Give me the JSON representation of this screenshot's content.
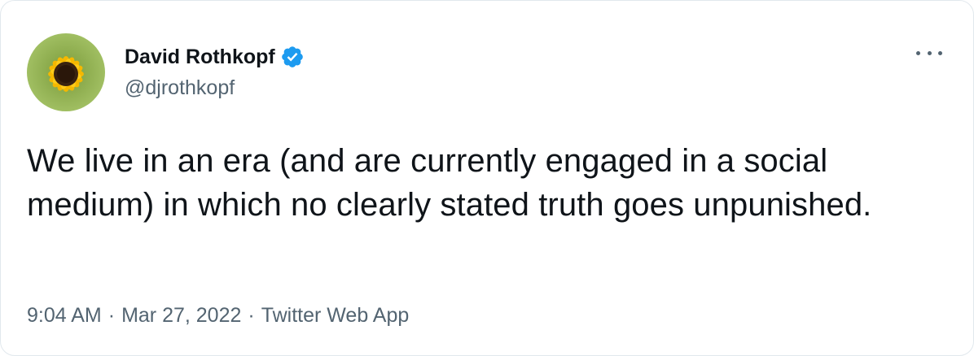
{
  "author": {
    "display_name": "David Rothkopf",
    "handle": "@djrothkopf",
    "verified": true,
    "avatar_icon": "sunflower-avatar"
  },
  "tweet": {
    "text": "We live in an era (and are currently engaged in a social medium) in which no clearly stated truth goes unpunished."
  },
  "meta": {
    "time": "9:04 AM",
    "date": "Mar 27, 2022",
    "source": "Twitter Web App",
    "separator": "·"
  },
  "colors": {
    "verified_blue": "#1d9bf0",
    "text_primary": "#0f1419",
    "text_secondary": "#536471"
  },
  "icons": {
    "more": "more-options-icon",
    "verified": "verified-badge-icon"
  }
}
